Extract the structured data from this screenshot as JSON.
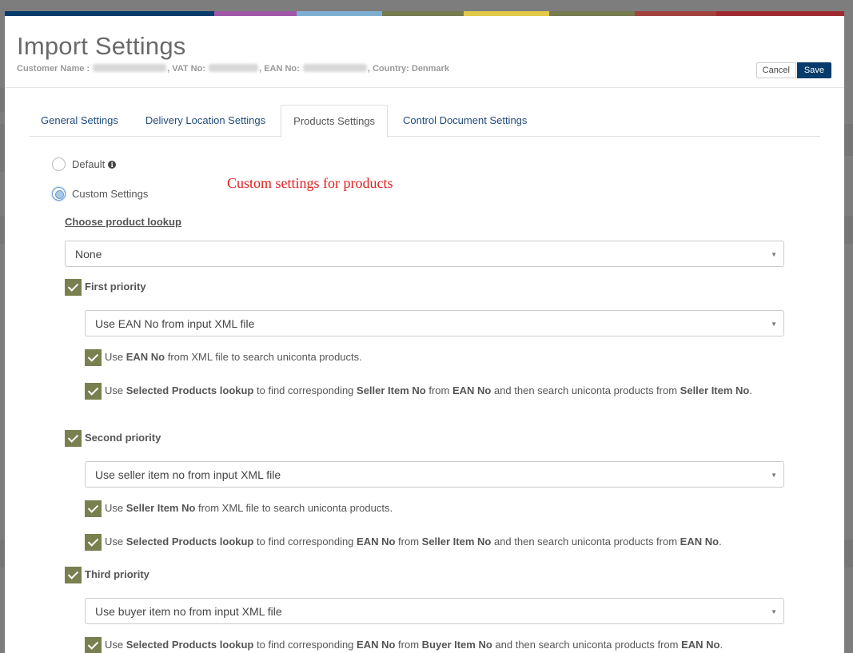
{
  "color_bar": [
    "#073b6b",
    "#073b6b",
    "#a057a8",
    "#7eafd3",
    "#767b50",
    "#e2c94a",
    "#767b50",
    "#a3413f",
    "#9e2a2f"
  ],
  "modal": {
    "title": "Import Settings",
    "customer": {
      "name_label": "Customer Name :",
      "vat_label": ", VAT No:",
      "ean_label": ", EAN No:",
      "country": ", Country: Denmark"
    },
    "cancel_label": "Cancel",
    "save_label": "Save"
  },
  "tabs": [
    {
      "label": "General Settings",
      "active": false
    },
    {
      "label": "Delivery Location Settings",
      "active": false
    },
    {
      "label": "Products Settings",
      "active": true
    },
    {
      "label": "Control Document Settings",
      "active": false
    }
  ],
  "products": {
    "default_label": "Default",
    "custom_label": "Custom Settings",
    "annotation": "Custom settings for products",
    "lookup_label": "Choose product lookup",
    "lookup_value": "None",
    "first": {
      "label": "First priority",
      "select": "Use EAN No from input XML file",
      "opt1": {
        "pre": "Use ",
        "b1": "EAN No",
        "post": " from XML file to search uniconta products."
      },
      "opt2": {
        "pre": "Use ",
        "b1": "Selected Products lookup",
        "mid1": " to find corresponding ",
        "b2": "Seller Item No",
        "mid2": " from ",
        "b3": "EAN No",
        "mid3": " and then search uniconta products from ",
        "b4": "Seller Item No",
        "end": "."
      }
    },
    "second": {
      "label": "Second priority",
      "select": "Use seller item no from input XML file",
      "opt1": {
        "pre": "Use ",
        "b1": "Seller Item No",
        "post": " from XML file to search uniconta products."
      },
      "opt2": {
        "pre": "Use ",
        "b1": "Selected Products lookup",
        "mid1": " to find corresponding ",
        "b2": "EAN No",
        "mid2": " from ",
        "b3": "Seller Item No",
        "mid3": " and then search uniconta products from ",
        "b4": "EAN No",
        "end": "."
      }
    },
    "third": {
      "label": "Third priority",
      "select": "Use buyer item no from input XML file",
      "opt1": {
        "pre": "Use ",
        "b1": "Selected Products lookup",
        "mid1": " to find corresponding ",
        "b2": "EAN No",
        "mid2": " from ",
        "b3": "Buyer Item No",
        "mid3": " and then search uniconta products from ",
        "b4": "EAN No",
        "end": "."
      }
    }
  }
}
